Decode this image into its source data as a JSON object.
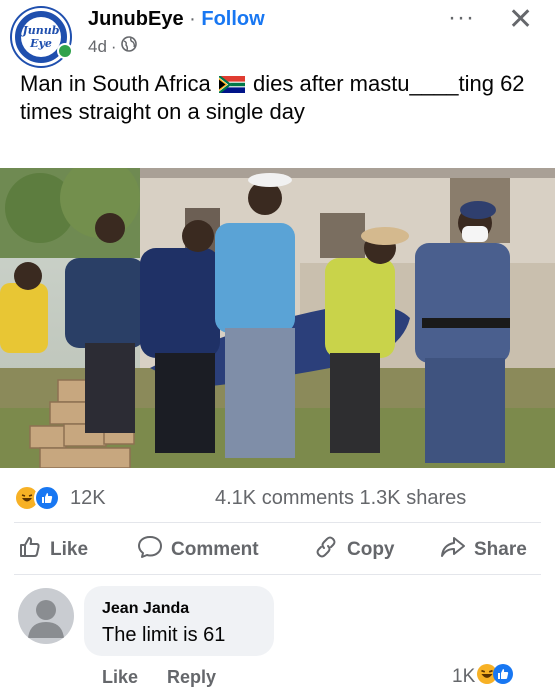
{
  "header": {
    "page_name": "JunubEye",
    "separator": " · ",
    "follow_label": "Follow",
    "age": "4d",
    "meta_separator": "·",
    "avatar_line1": "Junub",
    "avatar_line2": "Eye",
    "more_glyph": "···",
    "close_glyph": "✕"
  },
  "post": {
    "caption_part1": "Man in South Africa",
    "caption_part2": "dies after mastu____ting 62 times straight on a single day"
  },
  "stats": {
    "reactions": "12K",
    "comments_shares": "4.1K comments  1.3K shares"
  },
  "actions": {
    "like": "Like",
    "comment": "Comment",
    "copy": "Copy",
    "share": "Share"
  },
  "comment": {
    "author": "Jean Janda",
    "text": "The limit is 61",
    "like": "Like",
    "reply": "Reply",
    "reaction_count": "1K"
  },
  "colors": {
    "brand": "#1877f2",
    "muted": "#65676b",
    "online": "#31a24c"
  }
}
